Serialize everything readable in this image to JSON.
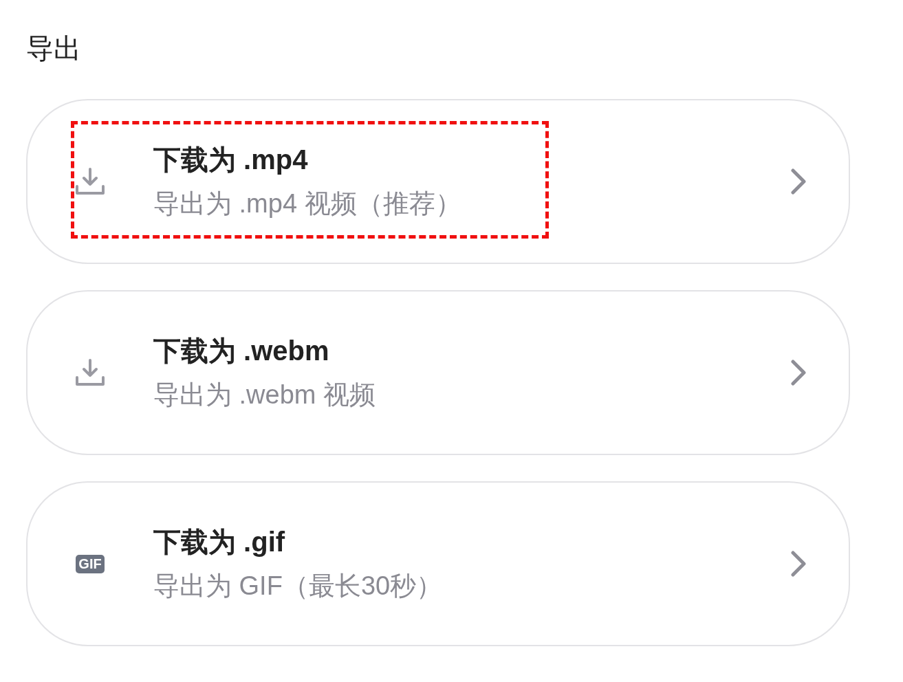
{
  "title": "导出",
  "options": [
    {
      "kind": "download",
      "title": "下载为 .mp4",
      "subtitle": "导出为 .mp4 视频（推荐）",
      "highlighted": true
    },
    {
      "kind": "download",
      "title": "下载为 .webm",
      "subtitle": "导出为 .webm 视频",
      "highlighted": false
    },
    {
      "kind": "badge",
      "badge": "GIF",
      "title": "下载为 .gif",
      "subtitle": "导出为 GIF（最长30秒）",
      "highlighted": false
    }
  ]
}
